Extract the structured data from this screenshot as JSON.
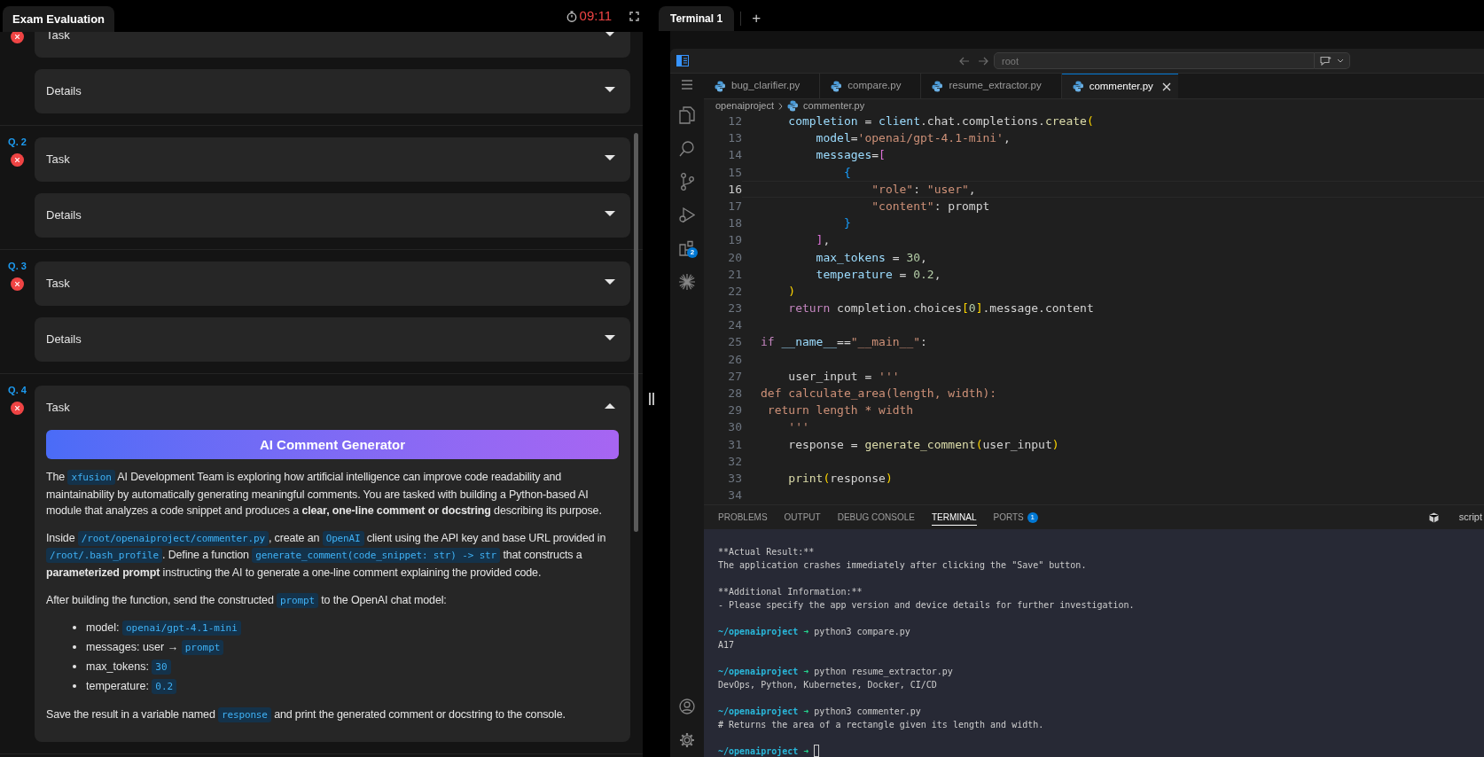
{
  "exam": {
    "title": "Exam Evaluation",
    "timer": "09:11",
    "questions": [
      {
        "sections": [
          {
            "title": "Task",
            "expanded": false
          },
          {
            "title": "Details",
            "expanded": false
          }
        ]
      },
      {
        "label": "Q. 2",
        "sections": [
          {
            "title": "Task",
            "expanded": false
          },
          {
            "title": "Details",
            "expanded": false
          }
        ]
      },
      {
        "label": "Q. 3",
        "sections": [
          {
            "title": "Task",
            "expanded": false
          },
          {
            "title": "Details",
            "expanded": false
          }
        ]
      },
      {
        "label": "Q. 4",
        "sections": [
          {
            "title": "Task",
            "expanded": true,
            "banner": "AI Comment Generator",
            "blocks": [
              {
                "kind": "paragraph",
                "segments": [
                  {
                    "kind": "text",
                    "text": "The "
                  },
                  {
                    "kind": "code",
                    "text": "xfusion"
                  },
                  {
                    "kind": "text",
                    "text": " AI Development Team is exploring how artificial intelligence can improve code readability and maintainability by automatically generating meaningful comments. You are tasked with building a Python-based AI module that analyzes a code snippet and produces a **clear, one-line comment or docstring** describing its purpose."
                  }
                ]
              },
              {
                "kind": "paragraph",
                "segments": [
                  {
                    "kind": "text",
                    "text": "Inside "
                  },
                  {
                    "kind": "code",
                    "text": "/root/openaiproject/commenter.py"
                  },
                  {
                    "kind": "text",
                    "text": ", create an "
                  },
                  {
                    "kind": "code",
                    "text": "OpenAI"
                  },
                  {
                    "kind": "text",
                    "text": " client using the API key and base URL provided in "
                  },
                  {
                    "kind": "code",
                    "text": "/root/.bash_profile"
                  },
                  {
                    "kind": "text",
                    "text": ". Define a function "
                  },
                  {
                    "kind": "code",
                    "text": "generate_comment(code_snippet: str) -> str"
                  },
                  {
                    "kind": "text",
                    "text": " that constructs a **parameterized prompt** instructing the AI to generate a one-line comment explaining the provided code."
                  }
                ]
              },
              {
                "kind": "paragraph",
                "segments": [
                  {
                    "kind": "text",
                    "text": "After building the function, send the constructed "
                  },
                  {
                    "kind": "code",
                    "text": "prompt"
                  },
                  {
                    "kind": "text",
                    "text": " to the OpenAI chat model:"
                  }
                ]
              },
              {
                "kind": "list",
                "items": [
                  [
                    {
                      "kind": "text",
                      "text": "model: "
                    },
                    {
                      "kind": "code",
                      "text": "openai/gpt-4.1-mini"
                    }
                  ],
                  [
                    {
                      "kind": "text",
                      "text": "messages: user → "
                    },
                    {
                      "kind": "code",
                      "text": "prompt"
                    }
                  ],
                  [
                    {
                      "kind": "text",
                      "text": "max_tokens: "
                    },
                    {
                      "kind": "code",
                      "text": "30"
                    }
                  ],
                  [
                    {
                      "kind": "text",
                      "text": "temperature: "
                    },
                    {
                      "kind": "code",
                      "text": "0.2"
                    }
                  ]
                ]
              },
              {
                "kind": "paragraph",
                "segments": [
                  {
                    "kind": "text",
                    "text": "Save the result in a variable named "
                  },
                  {
                    "kind": "code",
                    "text": "response"
                  },
                  {
                    "kind": "text",
                    "text": " and print the generated comment or docstring to the console."
                  }
                ]
              }
            ]
          }
        ]
      }
    ]
  },
  "terminal_tab": {
    "title": "Terminal 1",
    "add": "+"
  },
  "vscode": {
    "search": {
      "placeholder": "root"
    },
    "activity_badge": "2",
    "tabs": [
      {
        "label": "bug_clarifier.py",
        "selected": false
      },
      {
        "label": "compare.py",
        "selected": false
      },
      {
        "label": "resume_extractor.py",
        "selected": false
      },
      {
        "label": "commenter.py",
        "selected": true
      }
    ],
    "breadcrumb": [
      "openaiproject",
      "commenter.py"
    ],
    "code_lines": [
      {
        "number": "12",
        "current": false,
        "tokens": [
          {
            "text": "    completion",
            "kind": "variable"
          },
          {
            "text": " = ",
            "kind": "plain"
          },
          {
            "text": "client",
            "kind": "variable"
          },
          {
            "text": ".chat.completions.",
            "kind": "plain"
          },
          {
            "text": "create",
            "kind": "function"
          },
          {
            "text": "(",
            "kind": "bracket1"
          }
        ]
      },
      {
        "number": "13",
        "current": false,
        "tokens": [
          {
            "text": "        model",
            "kind": "variable"
          },
          {
            "text": "=",
            "kind": "plain"
          },
          {
            "text": "'openai/gpt-4.1-mini'",
            "kind": "string"
          },
          {
            "text": ",",
            "kind": "plain"
          }
        ]
      },
      {
        "number": "14",
        "current": false,
        "tokens": [
          {
            "text": "        messages",
            "kind": "variable"
          },
          {
            "text": "=",
            "kind": "plain"
          },
          {
            "text": "[",
            "kind": "bracket2"
          }
        ]
      },
      {
        "number": "15",
        "current": false,
        "tokens": [
          {
            "text": "            {",
            "kind": "bracket3"
          }
        ]
      },
      {
        "number": "16",
        "current": true,
        "tokens": [
          {
            "text": "                \"role\"",
            "kind": "string"
          },
          {
            "text": ": ",
            "kind": "plain"
          },
          {
            "text": "\"user\"",
            "kind": "string"
          },
          {
            "text": ",",
            "kind": "plain"
          }
        ]
      },
      {
        "number": "17",
        "current": false,
        "tokens": [
          {
            "text": "                \"content\"",
            "kind": "string"
          },
          {
            "text": ": prompt",
            "kind": "plain"
          }
        ]
      },
      {
        "number": "18",
        "current": false,
        "tokens": [
          {
            "text": "            }",
            "kind": "bracket3"
          }
        ]
      },
      {
        "number": "19",
        "current": false,
        "tokens": [
          {
            "text": "        ]",
            "kind": "bracket2"
          },
          {
            "text": ",",
            "kind": "plain"
          }
        ]
      },
      {
        "number": "20",
        "current": false,
        "tokens": [
          {
            "text": "        max_tokens",
            "kind": "variable"
          },
          {
            "text": " = ",
            "kind": "plain"
          },
          {
            "text": "30",
            "kind": "number"
          },
          {
            "text": ",",
            "kind": "plain"
          }
        ]
      },
      {
        "number": "21",
        "current": false,
        "tokens": [
          {
            "text": "        temperature",
            "kind": "variable"
          },
          {
            "text": " = ",
            "kind": "plain"
          },
          {
            "text": "0.2",
            "kind": "number"
          },
          {
            "text": ",",
            "kind": "plain"
          }
        ]
      },
      {
        "number": "22",
        "current": false,
        "tokens": [
          {
            "text": "    )",
            "kind": "bracket1"
          }
        ]
      },
      {
        "number": "23",
        "current": false,
        "tokens": [
          {
            "text": "    return",
            "kind": "keyword"
          },
          {
            "text": " completion.choices",
            "kind": "plain"
          },
          {
            "text": "[",
            "kind": "bracket1"
          },
          {
            "text": "0",
            "kind": "number"
          },
          {
            "text": "]",
            "kind": "bracket1"
          },
          {
            "text": ".message.content",
            "kind": "plain"
          }
        ]
      },
      {
        "number": "24",
        "current": false
      },
      {
        "number": "25",
        "current": false,
        "tokens": [
          {
            "text": "if ",
            "kind": "keyword"
          },
          {
            "text": "__name__",
            "kind": "variable"
          },
          {
            "text": "==",
            "kind": "plain"
          },
          {
            "text": "\"__main__\"",
            "kind": "string"
          },
          {
            "text": ":",
            "kind": "plain"
          }
        ]
      },
      {
        "number": "26",
        "current": false
      },
      {
        "number": "27",
        "current": false,
        "tokens": [
          {
            "text": "    user_input = ",
            "kind": "plain"
          },
          {
            "text": "'''",
            "kind": "string"
          }
        ]
      },
      {
        "number": "28",
        "current": false,
        "tokens": [
          {
            "text": "def calculate_area(length, width):",
            "kind": "string"
          }
        ]
      },
      {
        "number": "29",
        "current": false,
        "tokens": [
          {
            "text": " return length * width",
            "kind": "string"
          }
        ]
      },
      {
        "number": "30",
        "current": false,
        "tokens": [
          {
            "text": "    '''",
            "kind": "string"
          }
        ]
      },
      {
        "number": "31",
        "current": false,
        "tokens": [
          {
            "text": "    response = ",
            "kind": "plain"
          },
          {
            "text": "generate_comment",
            "kind": "function"
          },
          {
            "text": "(",
            "kind": "bracket1"
          },
          {
            "text": "user_input",
            "kind": "plain"
          },
          {
            "text": ")",
            "kind": "bracket1"
          }
        ]
      },
      {
        "number": "32",
        "current": false
      },
      {
        "number": "33",
        "current": false,
        "tokens": [
          {
            "text": "    print",
            "kind": "function"
          },
          {
            "text": "(",
            "kind": "bracket1"
          },
          {
            "text": "response",
            "kind": "plain"
          },
          {
            "text": ")",
            "kind": "bracket1"
          }
        ]
      },
      {
        "number": "34",
        "current": false
      }
    ],
    "panel_tabs": [
      {
        "label": "PROBLEMS",
        "selected": false
      },
      {
        "label": "OUTPUT",
        "selected": false
      },
      {
        "label": "DEBUG CONSOLE",
        "selected": false
      },
      {
        "label": "TERMINAL",
        "selected": true
      },
      {
        "label": "PORTS",
        "selected": false,
        "badge": "1"
      }
    ],
    "shell": "script",
    "terminal_blocks": [
      [
        {
          "kind": "output",
          "text": "**Actual Result:**"
        },
        {
          "kind": "output",
          "text": "The application crashes immediately after clicking the \"Save\" button."
        }
      ],
      [
        {
          "kind": "output",
          "text": "**Additional Information:**"
        },
        {
          "kind": "output",
          "text": "- Please specify the app version and device details for further investigation."
        }
      ],
      [
        {
          "kind": "prompt",
          "path": "~/openaiproject",
          "arrow": "➜",
          "command": "python3 compare.py"
        },
        {
          "kind": "output",
          "text": "A17"
        }
      ],
      [
        {
          "kind": "prompt",
          "path": "~/openaiproject",
          "arrow": "➜",
          "command": "python resume_extractor.py"
        },
        {
          "kind": "output",
          "text": "DevOps, Python, Kubernetes, Docker, CI/CD"
        }
      ],
      [
        {
          "kind": "prompt",
          "path": "~/openaiproject",
          "arrow": "➜",
          "command": "python3 commenter.py"
        },
        {
          "kind": "output",
          "text": "# Returns the area of a rectangle given its length and width."
        }
      ],
      [
        {
          "kind": "prompt",
          "path": "~/openaiproject",
          "arrow": "➜",
          "cursor": true
        }
      ]
    ]
  }
}
